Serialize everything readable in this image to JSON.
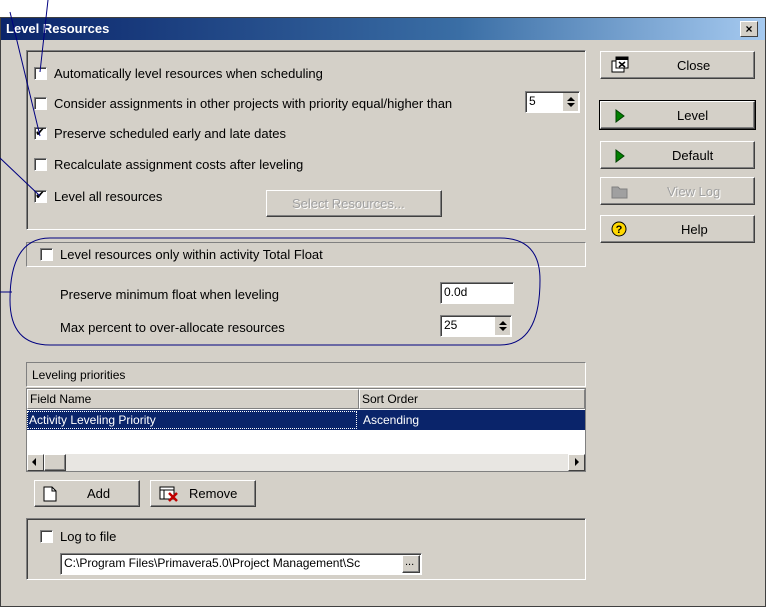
{
  "dialog": {
    "title": "Level Resources",
    "close_glyph": "×"
  },
  "options": [
    {
      "label": "Automatically level resources when scheduling",
      "checked": false
    },
    {
      "label": "Consider assignments in other projects with priority equal/higher than",
      "checked": false
    },
    {
      "label": "Preserve scheduled early and late dates",
      "checked": true
    },
    {
      "label": "Recalculate assignment costs after leveling",
      "checked": false
    },
    {
      "label": "Level all resources",
      "checked": true
    }
  ],
  "priority_value": "5",
  "select_resources_label": "Select Resources...",
  "total_float": {
    "label": "Level resources only within activity Total Float",
    "checked": false,
    "min_float_label": "Preserve minimum float when leveling",
    "min_float_value": "0.0d",
    "overalloc_label": "Max percent to over-allocate resources",
    "overalloc_value": "25"
  },
  "priorities": {
    "title": "Leveling priorities",
    "columns": [
      "Field Name",
      "Sort Order"
    ],
    "rows": [
      {
        "field": "Activity Leveling Priority",
        "order": "Ascending"
      }
    ],
    "add_label": "Add",
    "remove_label": "Remove"
  },
  "log": {
    "label": "Log to file",
    "checked": false,
    "path": "C:\\Program Files\\Primavera5.0\\Project Management\\Sc",
    "browse_label": "..."
  },
  "side_buttons": {
    "close": "Close",
    "level": "Level",
    "default": "Default",
    "view_log": "View Log",
    "help": "Help"
  },
  "colors": {
    "title_start": "#0a246a",
    "title_end": "#a6caf0",
    "selection": "#0a246a",
    "face": "#d4d0c8",
    "callout": "#000080",
    "play_green": "#008000"
  }
}
